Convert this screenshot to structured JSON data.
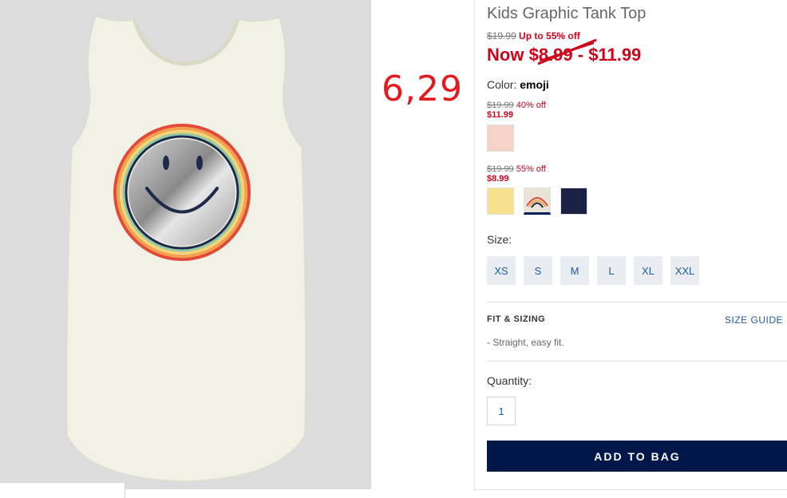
{
  "product": {
    "title": "Kids Graphic Tank Top",
    "original_price": "$19.99",
    "discount_text": "Up to 55% off",
    "now_label": "Now",
    "now_low": "$8.99",
    "now_sep": "-",
    "now_high": "$11.99"
  },
  "annotation": {
    "text": "6,29"
  },
  "color": {
    "label": "Color:",
    "value": "emoji",
    "groups": [
      {
        "was": "$19.99",
        "pct": "40% off",
        "now": "$11.99",
        "swatches": [
          {
            "name": "pink",
            "hex": "#f6d3c9"
          }
        ]
      },
      {
        "was": "$19.99",
        "pct": "55% off",
        "now": "$8.99",
        "swatches": [
          {
            "name": "yellow",
            "hex": "#f7e08e"
          },
          {
            "name": "emoji",
            "hex": "#e8e4d9"
          },
          {
            "name": "navy",
            "hex": "#1a2145"
          }
        ]
      }
    ]
  },
  "size": {
    "label": "Size:",
    "options": [
      "XS",
      "S",
      "M",
      "L",
      "XL",
      "XXL"
    ]
  },
  "fit": {
    "heading": "FIT & SIZING",
    "guide_link": "SIZE GUIDE",
    "note": "- Straight, easy fit."
  },
  "quantity": {
    "label": "Quantity:",
    "value": "1"
  },
  "cta": {
    "add_to_bag": "ADD TO BAG"
  },
  "colors": {
    "sale_red": "#d0021b",
    "link_blue": "#1e5aa8",
    "button_navy": "#001749"
  }
}
